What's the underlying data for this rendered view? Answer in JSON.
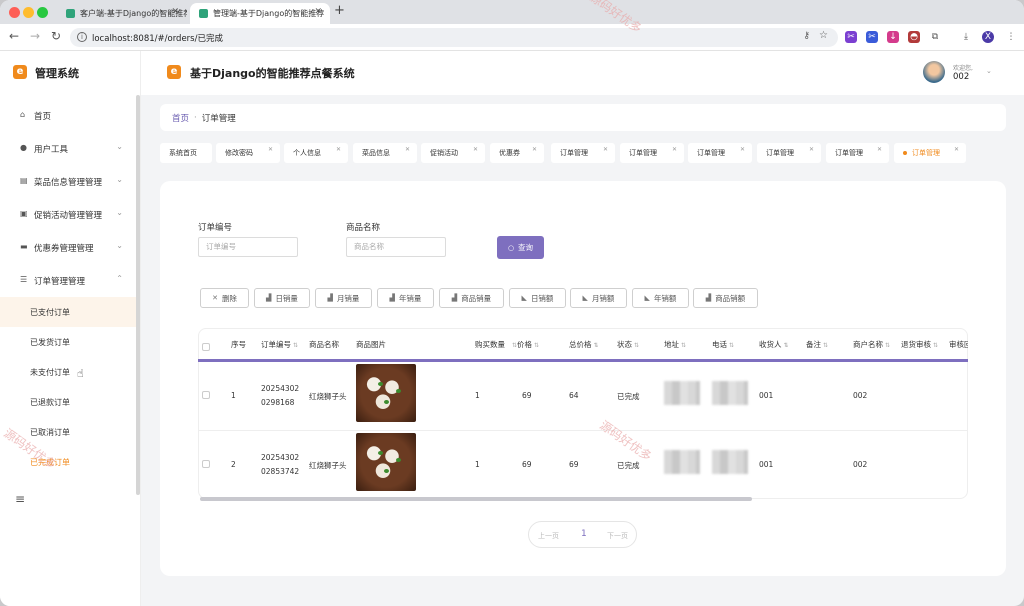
{
  "browser": {
    "tabs": [
      {
        "label": "客户端-基于Django的智能推荐"
      },
      {
        "label": "管理端-基于Django的智能推荐"
      }
    ],
    "url": "localhost:8081/#/orders/已完成",
    "profile": "X"
  },
  "sidebar": {
    "title": "管理系统",
    "items": [
      {
        "label": "首页",
        "icon": "home-icon"
      },
      {
        "label": "用户工具",
        "icon": "user-icon"
      },
      {
        "label": "菜品信息管理管理",
        "icon": "briefcase-icon"
      },
      {
        "label": "促销活动管理管理",
        "icon": "document-icon"
      },
      {
        "label": "优惠券管理管理",
        "icon": "monitor-icon"
      },
      {
        "label": "订单管理管理",
        "icon": "sliders-icon"
      }
    ],
    "subitems": [
      {
        "label": "已支付订单"
      },
      {
        "label": "已发货订单"
      },
      {
        "label": "未支付订单"
      },
      {
        "label": "已退款订单"
      },
      {
        "label": "已取消订单"
      },
      {
        "label": "已完成订单"
      }
    ]
  },
  "header": {
    "title": "基于Django的智能推荐点餐系统",
    "welcome": "欢迎您,",
    "username": "002"
  },
  "breadcrumb": {
    "home": "首页",
    "sep": "·",
    "current": "订单管理"
  },
  "tags": [
    {
      "label": "系统首页"
    },
    {
      "label": "修改密码"
    },
    {
      "label": "个人信息"
    },
    {
      "label": "菜品信息"
    },
    {
      "label": "促销活动"
    },
    {
      "label": "优惠券"
    },
    {
      "label": "订单管理"
    },
    {
      "label": "订单管理"
    },
    {
      "label": "订单管理"
    },
    {
      "label": "订单管理"
    },
    {
      "label": "订单管理"
    },
    {
      "label": "订单管理"
    }
  ],
  "filters": {
    "order_no_label": "订单编号",
    "order_no_placeholder": "订单编号",
    "dish_name_label": "商品名称",
    "dish_name_placeholder": "商品名称",
    "query_label": "查询"
  },
  "actions": [
    "删除",
    "日销量",
    "月销量",
    "年销量",
    "商品销量",
    "日销额",
    "月销额",
    "年销额",
    "商品销额"
  ],
  "table": {
    "columns": [
      "序号",
      "订单编号",
      "商品名称",
      "商品图片",
      "购买数量",
      "价格",
      "总价格",
      "状态",
      "地址",
      "电话",
      "收货人",
      "备注",
      "商户名称",
      "退货审核",
      "审核回"
    ],
    "rows": [
      {
        "index": "1",
        "order_no_1": "20254302",
        "order_no_2": "0298168",
        "dish": "红烧狮子头",
        "qty": "1",
        "price": "69",
        "total": "64",
        "status": "已完成",
        "receiver": "001",
        "remark": "",
        "merchant": "002"
      },
      {
        "index": "2",
        "order_no_1": "20254302",
        "order_no_2": "02853742",
        "dish": "红烧狮子头",
        "qty": "1",
        "price": "69",
        "total": "69",
        "status": "已完成",
        "receiver": "001",
        "remark": "",
        "merchant": "002"
      }
    ]
  },
  "pagination": {
    "prev": "上一页",
    "page": "1",
    "next": "下一页"
  },
  "watermarks": [
    "源码好优多",
    "源码好优多",
    "源码好优多"
  ],
  "colors": {
    "accent": "#7e6fbf",
    "brand": "#f08a1c"
  }
}
